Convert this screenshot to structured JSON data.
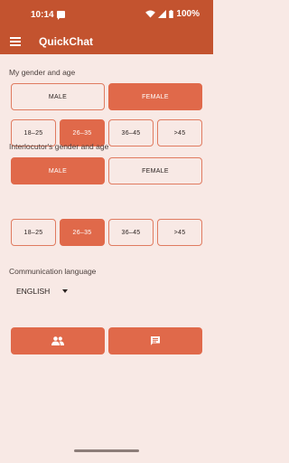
{
  "status": {
    "time": "10:14",
    "battery": "100%"
  },
  "app": {
    "title": "QuickChat"
  },
  "my": {
    "label": "My gender and age",
    "gender": [
      "MALE",
      "FEMALE"
    ],
    "ages": [
      "18–25",
      "26–35",
      "36–45",
      ">45"
    ],
    "selected_gender": "FEMALE",
    "selected_age": "26–35"
  },
  "interlocutor": {
    "label": "Interlocutor's gender and age",
    "gender": [
      "MALE",
      "FEMALE"
    ],
    "ages": [
      "18–25",
      "26–35",
      "36–45",
      ">45"
    ],
    "selected_gender": "MALE",
    "selected_age": "26–35"
  },
  "language": {
    "label": "Communication language",
    "value": "ENGLISH"
  },
  "actions": {
    "left_icon": "people-icon",
    "right_icon": "chat-icon"
  },
  "colors": {
    "primary": "#c3532f",
    "accent": "#e0694a",
    "background": "#f8e9e5"
  }
}
